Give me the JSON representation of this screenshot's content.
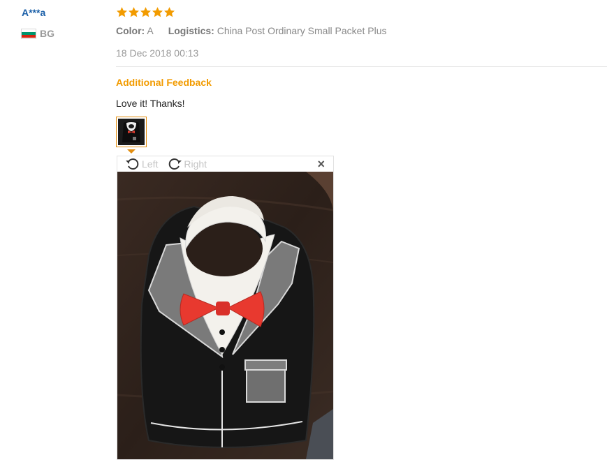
{
  "reviewer": {
    "name": "A***a",
    "country_code": "BG",
    "flag_icon": "bulgaria-flag-icon"
  },
  "review": {
    "rating": 5,
    "rating_max": 5,
    "star_color": "#f29b00",
    "color_label": "Color:",
    "color_value": "A",
    "logistics_label": "Logistics:",
    "logistics_value": "China Post Ordinary Small Packet Plus",
    "date": "18 Dec 2018 00:13",
    "additional_feedback_title": "Additional Feedback",
    "feedback_text": "Love it! Thanks!"
  },
  "viewer": {
    "rotate_left_label": "Left",
    "rotate_right_label": "Right",
    "close_label": "×",
    "photo_subject": "baby bib with tuxedo print and red bow tie"
  },
  "colors": {
    "username": "#1a5fa8",
    "accent_orange": "#f29b00",
    "thumb_border": "#e28e10"
  }
}
